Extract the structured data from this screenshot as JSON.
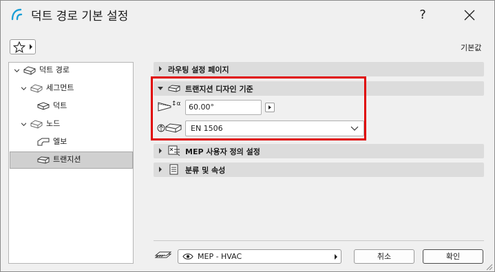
{
  "window": {
    "title": "덕트 경로 기본 설정",
    "help_label": "?",
    "defaults_label": "기본값"
  },
  "tree": {
    "items": [
      {
        "label": "덕트 경로",
        "icon": "duct-route-icon",
        "expanded": true
      },
      {
        "label": "세그먼트",
        "icon": "segment-icon",
        "expanded": true
      },
      {
        "label": "덕트",
        "icon": "duct-icon"
      },
      {
        "label": "노드",
        "icon": "node-icon",
        "expanded": true
      },
      {
        "label": "엘보",
        "icon": "elbow-icon"
      },
      {
        "label": "트랜지션",
        "icon": "transition-icon",
        "selected": true
      }
    ]
  },
  "panels": {
    "routing": {
      "label": "라우팅 설정 페이지",
      "expanded": false
    },
    "transition": {
      "label": "트랜지션 디자인 기준",
      "expanded": true
    },
    "mep_custom": {
      "label": "MEP 사용자 정의 설정",
      "expanded": false
    },
    "classification": {
      "label": "분류 및 속성",
      "expanded": false
    }
  },
  "transition_settings": {
    "angle_symbol": "α",
    "angle_value": "60.00°",
    "standard_value": "EN 1506"
  },
  "footer": {
    "layer_value": "MEP - HVAC",
    "cancel_label": "취소",
    "ok_label": "확인"
  },
  "colors": {
    "highlight": "#e00000",
    "accent": "#1a9fd6"
  }
}
